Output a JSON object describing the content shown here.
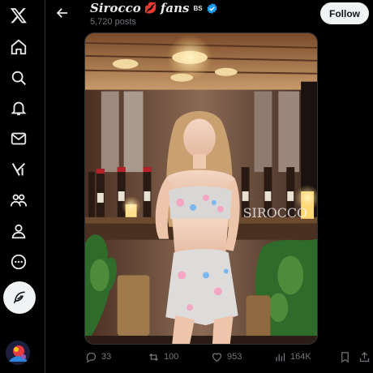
{
  "nav": {
    "items": [
      {
        "name": "x-logo-icon"
      },
      {
        "name": "home-icon"
      },
      {
        "name": "explore-icon"
      },
      {
        "name": "notifications-icon"
      },
      {
        "name": "messages-icon"
      },
      {
        "name": "grok-icon"
      },
      {
        "name": "communities-icon"
      },
      {
        "name": "profile-icon"
      },
      {
        "name": "more-icon"
      }
    ],
    "compose_icon": "feather-icon"
  },
  "header": {
    "display_name": "Sirocco",
    "display_name_emoji": "💋",
    "display_name_rest": "fans",
    "suffix": "BS",
    "verified": true,
    "post_count": "5,720 posts",
    "follow_label": "Follow"
  },
  "post": {
    "watermark": "SIROCCO",
    "stats": {
      "replies": "33",
      "reposts": "100",
      "likes": "953",
      "views": "164K"
    }
  },
  "colors": {
    "background": "#000000",
    "verified": "#1d9bf0",
    "muted_text": "#71767b",
    "follow_bg": "#eff3f4"
  }
}
